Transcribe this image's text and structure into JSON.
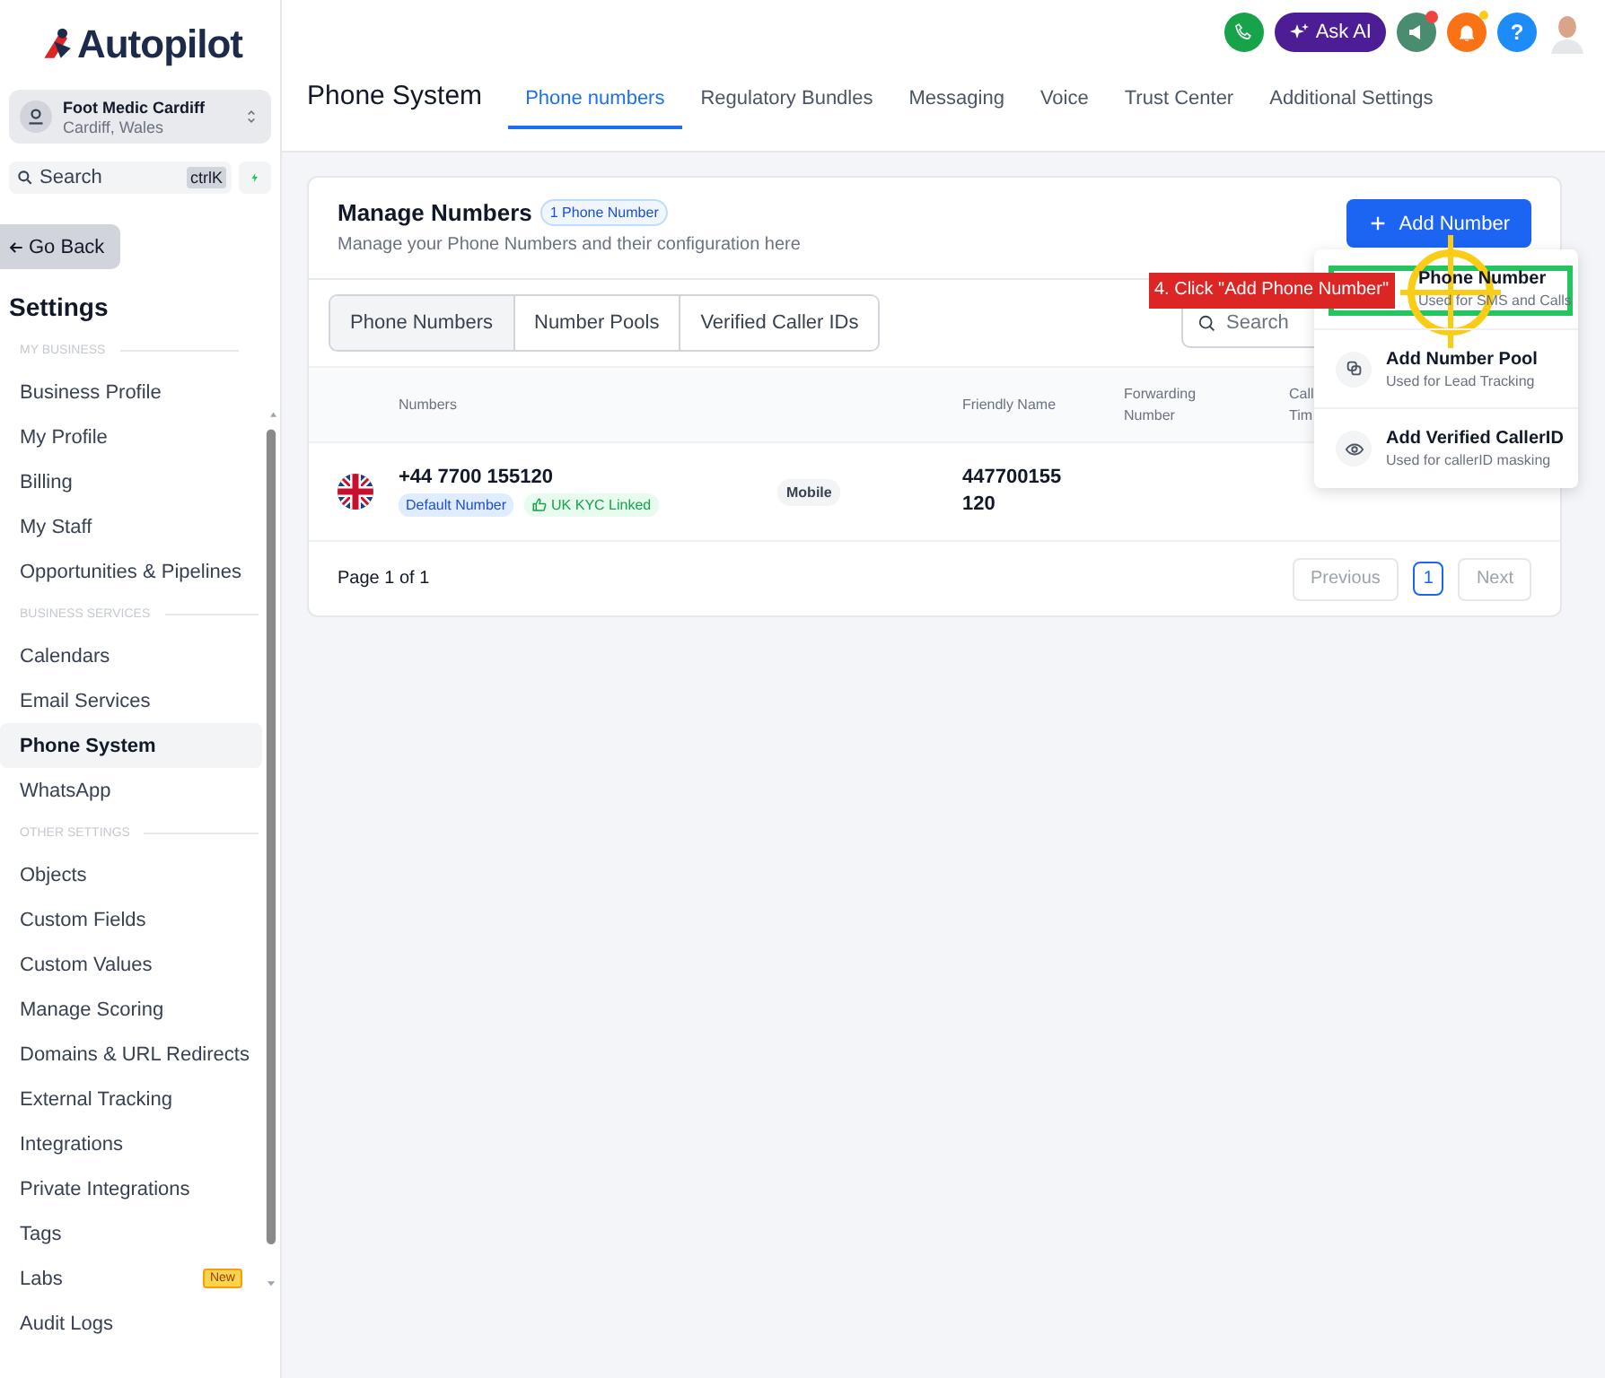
{
  "sidebar": {
    "logo": "Autopilot",
    "account": {
      "name": "Foot Medic Cardiff",
      "location": "Cardiff, Wales"
    },
    "search": {
      "placeholder": "Search",
      "shortcut": "ctrlK"
    },
    "back_button": "Go Back",
    "heading": "Settings",
    "items": [
      {
        "kind": "section",
        "label": "MY BUSINESS"
      },
      {
        "kind": "item",
        "label": "Business Profile",
        "selected": false
      },
      {
        "kind": "item",
        "label": "My Profile",
        "selected": false
      },
      {
        "kind": "item",
        "label": "Billing",
        "selected": false
      },
      {
        "kind": "item",
        "label": "My Staff",
        "selected": false
      },
      {
        "kind": "item",
        "label": "Opportunities & Pipelines",
        "selected": false
      },
      {
        "kind": "section",
        "label": "BUSINESS SERVICES"
      },
      {
        "kind": "item",
        "label": "Calendars",
        "selected": false
      },
      {
        "kind": "item",
        "label": "Email Services",
        "selected": false
      },
      {
        "kind": "item",
        "label": "Phone System",
        "selected": true
      },
      {
        "kind": "item",
        "label": "WhatsApp",
        "selected": false
      },
      {
        "kind": "section",
        "label": "OTHER SETTINGS"
      },
      {
        "kind": "item",
        "label": "Objects",
        "selected": false
      },
      {
        "kind": "item",
        "label": "Custom Fields",
        "selected": false
      },
      {
        "kind": "item",
        "label": "Custom Values",
        "selected": false
      },
      {
        "kind": "item",
        "label": "Manage Scoring",
        "selected": false
      },
      {
        "kind": "item",
        "label": "Domains & URL Redirects",
        "selected": false
      },
      {
        "kind": "item",
        "label": "External Tracking",
        "selected": false
      },
      {
        "kind": "item",
        "label": "Integrations",
        "selected": false
      },
      {
        "kind": "item",
        "label": "Private Integrations",
        "selected": false
      },
      {
        "kind": "item",
        "label": "Tags",
        "selected": false
      },
      {
        "kind": "item",
        "label": "Labs",
        "selected": false,
        "badge": "New"
      },
      {
        "kind": "item",
        "label": "Audit Logs",
        "selected": false
      }
    ]
  },
  "topbar": {
    "ask_ai": "Ask AI",
    "help": "?"
  },
  "page": {
    "title": "Phone System",
    "tabs": [
      {
        "label": "Phone numbers",
        "selected": true
      },
      {
        "label": "Regulatory Bundles",
        "selected": false
      },
      {
        "label": "Messaging",
        "selected": false
      },
      {
        "label": "Voice",
        "selected": false
      },
      {
        "label": "Trust Center",
        "selected": false
      },
      {
        "label": "Additional Settings",
        "selected": false
      }
    ]
  },
  "card": {
    "title": "Manage Numbers",
    "count_badge": "1 Phone Number",
    "subtitle": "Manage your Phone Numbers and their configuration here",
    "add_button": "Add Number",
    "segments": [
      {
        "label": "Phone Numbers",
        "selected": true
      },
      {
        "label": "Number Pools",
        "selected": false
      },
      {
        "label": "Verified Caller IDs",
        "selected": false
      }
    ],
    "search": {
      "placeholder": "Search"
    },
    "table": {
      "columns": [
        "Numbers",
        "Friendly Name",
        "Forwarding Number",
        "Call Tim"
      ],
      "rows": [
        {
          "number": "+44 7700 155120",
          "tags": [
            {
              "kind": "default",
              "label": "Default Number"
            },
            {
              "kind": "kyc",
              "label": "UK KYC Linked"
            }
          ],
          "type": "Mobile",
          "friendly_name": "447700155 120"
        }
      ]
    },
    "pagination": {
      "summary": "Page 1 of 1",
      "previous": "Previous",
      "pages": [
        {
          "label": "1",
          "selected": true
        }
      ],
      "next": "Next"
    }
  },
  "dropdown": {
    "items": [
      {
        "kind": "phone",
        "title": "Phone Number",
        "subtitle": "Used for SMS and Calls"
      },
      {
        "kind": "pool",
        "title": "Add Number Pool",
        "subtitle": "Used for Lead Tracking"
      },
      {
        "kind": "caller",
        "title": "Add Verified CallerID",
        "subtitle": "Used for callerID masking"
      }
    ]
  },
  "callout": {
    "text": "4. Click \"Add Phone Number\""
  }
}
